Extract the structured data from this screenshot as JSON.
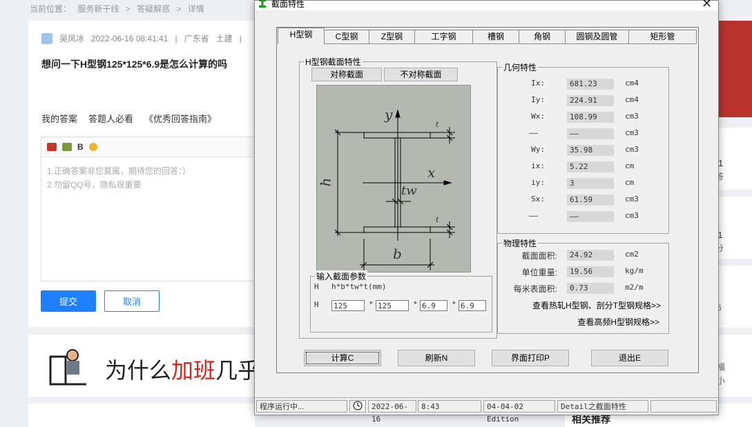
{
  "page": {
    "breadcrumb": [
      "当前位置：",
      "服务新干线",
      ">",
      "答疑解惑",
      ">",
      "详情"
    ],
    "question": {
      "author": "吴凤冰",
      "datetime": "2022-06-16 08:41:41",
      "sep1": "|",
      "region": "广东省",
      "category": "土建",
      "sep2": "|",
      "title": "想问一下H型钢125*125*6.9是怎么计算的吗"
    },
    "answer_tabs": [
      "我的答案",
      "答题人必看",
      "《优秀回答指南》"
    ],
    "editor": {
      "bold_label": "B",
      "hint_line1": "1.正确答案非您莫属，期待您的回答：）",
      "hint_line2": "2.勿留QQ号，隐私很重要"
    },
    "submit_label": "提交",
    "cancel_label": "取消",
    "banner": {
      "text_before": "为什么",
      "text_highlight": "加班",
      "text_after": "几乎"
    },
    "right_col": {
      "frag1": "1",
      "frag2": "答",
      "frag3": "91",
      "frag4": "分",
      "frag5": "6",
      "frag6": "福",
      "frag7": "小",
      "related": "相关推荐"
    }
  },
  "dialog": {
    "title": "截面特性",
    "close_glyph": "✕",
    "tabs": [
      "H型钢",
      "C型钢",
      "Z型钢",
      "工字钢",
      "槽钢",
      "角钢",
      "圆钢及圆管",
      "矩形管"
    ],
    "section_group_title": "H型钢截面特性",
    "sym_btn": "对称截面",
    "asym_btn": "不对称截面",
    "diagram": {
      "y_label": "y",
      "x_label": "x",
      "h_label": "h",
      "b_label": "b",
      "tw_label": "tw",
      "t_label": "t"
    },
    "input_group": {
      "title": "输入截面参数",
      "type": "H",
      "formula": "h*b*tw*t(mm)",
      "row_label": "H",
      "sep": "*",
      "h": "125",
      "b": "125",
      "tw": "6.9",
      "t": "6.9"
    },
    "geom_group": {
      "title": "几何特性",
      "rows": [
        {
          "label": "Ix:",
          "value": "681.23",
          "unit": "cm4"
        },
        {
          "label": "Iy:",
          "value": "224.91",
          "unit": "cm4"
        },
        {
          "label": "Wx:",
          "value": "108.99",
          "unit": "cm3"
        },
        {
          "label": "——",
          "value": "——",
          "unit": "cm3"
        },
        {
          "label": "Wy:",
          "value": "35.98",
          "unit": "cm3"
        },
        {
          "label": "ix:",
          "value": "5.22",
          "unit": "cm"
        },
        {
          "label": "iy:",
          "value": "3",
          "unit": "cm"
        },
        {
          "label": "Sx:",
          "value": "61.59",
          "unit": "cm3"
        },
        {
          "label": "——",
          "value": "——",
          "unit": "cm3"
        }
      ]
    },
    "phys_group": {
      "title": "物理特性",
      "rows": [
        {
          "label": "截面面积:",
          "value": "24.92",
          "unit": "cm2"
        },
        {
          "label": "单位重量:",
          "value": "19.56",
          "unit": "kg/m"
        },
        {
          "label": "每米表面积:",
          "value": "0.73",
          "unit": "m2/m"
        }
      ],
      "link1": "查看热轧H型钢、剖分T型钢规格>>",
      "link2": "查看高频H型钢规格>>"
    },
    "buttons": {
      "calc": "计算C",
      "refresh": "刷新N",
      "print": "界面打印P",
      "exit": "退出E"
    },
    "status": {
      "running": "程序运行中...",
      "date": "2022-06-16",
      "time": "8:43",
      "edition": "04-04-02 Edition",
      "detail": "Detail之截面特性"
    }
  }
}
